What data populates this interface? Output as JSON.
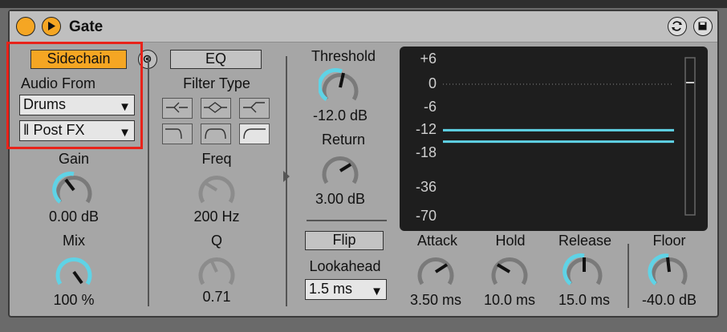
{
  "device": {
    "title": "Gate",
    "power_icon": "power-circle-icon",
    "play_icon": "play-icon",
    "top_right_icons": [
      "refresh-icon",
      "save-icon"
    ]
  },
  "sidechain": {
    "button_label": "Sidechain",
    "audio_from_label": "Audio From",
    "source_value": "Drums",
    "tap_value": "Post FX",
    "gain_label": "Gain",
    "gain_value": "0.00 dB",
    "gain_level": 0.5,
    "mix_label": "Mix",
    "mix_value": "100 %",
    "mix_level": 1.0
  },
  "eq": {
    "button_label": "EQ",
    "filter_type_label": "Filter Type",
    "filter_icons": [
      "lowpass-filter-icon",
      "bandpass-filter-icon",
      "highpass-filter-icon",
      "lowshelf-filter-icon",
      "peak-filter-icon",
      "highshelf-filter-icon"
    ],
    "freq_label": "Freq",
    "freq_value": "200 Hz",
    "q_label": "Q",
    "q_value": "0.71"
  },
  "gate": {
    "threshold_label": "Threshold",
    "threshold_value": "-12.0 dB",
    "return_label": "Return",
    "return_value": "3.00 dB",
    "flip_label": "Flip",
    "lookahead_label": "Lookahead",
    "lookahead_value": "1.5 ms",
    "attack_label": "Attack",
    "attack_value": "3.50 ms",
    "hold_label": "Hold",
    "hold_value": "10.0 ms",
    "release_label": "Release",
    "release_value": "15.0 ms",
    "floor_label": "Floor",
    "floor_value": "-40.0 dB"
  },
  "display": {
    "scale": [
      "+6",
      "0",
      "-6",
      "-12",
      "-18",
      "-36",
      "-70"
    ],
    "threshold_line_db": -12,
    "return_line_db": -15,
    "line_color": "#5fd3e6"
  },
  "colors": {
    "accent": "#f5a623",
    "highlight_box": "#e8231a",
    "knob_arc": "#5fd3e6"
  }
}
